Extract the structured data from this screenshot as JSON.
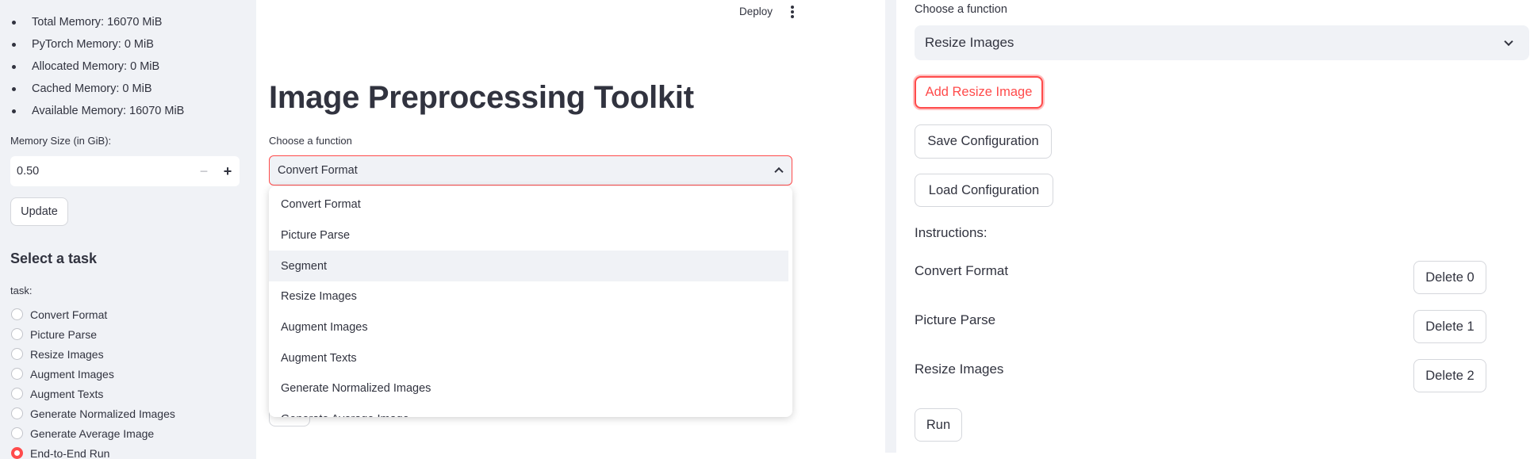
{
  "sidebar": {
    "memory_stats": [
      "Total Memory: 16070 MiB",
      "PyTorch Memory: 0 MiB",
      "Allocated Memory: 0 MiB",
      "Cached Memory: 0 MiB",
      "Available Memory: 16070 MiB"
    ],
    "memory_size_label": "Memory Size (in GiB):",
    "memory_size_value": "0.50",
    "minus_symbol": "−",
    "plus_symbol": "+",
    "update_label": "Update",
    "task_heading": "Select a task",
    "task_label": "task:",
    "tasks": [
      {
        "label": "Convert Format",
        "selected": false
      },
      {
        "label": "Picture Parse",
        "selected": false
      },
      {
        "label": "Resize Images",
        "selected": false
      },
      {
        "label": "Augment Images",
        "selected": false
      },
      {
        "label": "Augment Texts",
        "selected": false
      },
      {
        "label": "Generate Normalized Images",
        "selected": false
      },
      {
        "label": "Generate Average Image",
        "selected": false
      },
      {
        "label": "End-to-End Run",
        "selected": true
      }
    ]
  },
  "header": {
    "deploy_label": "Deploy",
    "menu_icon": "kebab-menu-icon"
  },
  "main": {
    "title": "Image Preprocessing Toolkit",
    "choose_label": "Choose a function",
    "selected_function": "Convert Format",
    "dropdown_options": [
      "Convert Format",
      "Picture Parse",
      "Segment",
      "Resize Images",
      "Augment Images",
      "Augment Texts",
      "Generate Normalized Images",
      "Generate Average Image"
    ],
    "highlighted_option": "Segment"
  },
  "right": {
    "choose_label": "Choose a function",
    "selected_function": "Resize Images",
    "add_label": "Add Resize Image",
    "save_label": "Save Configuration",
    "load_label": "Load Configuration",
    "instructions_label": "Instructions:",
    "instructions": [
      {
        "name": "Convert Format",
        "delete_label": "Delete 0"
      },
      {
        "name": "Picture Parse",
        "delete_label": "Delete 1"
      },
      {
        "name": "Resize Images",
        "delete_label": "Delete 2"
      }
    ],
    "run_label": "Run"
  },
  "colors": {
    "accent": "#ff4b4b",
    "sidebar_bg": "#f0f2f6",
    "text": "#31333f"
  }
}
